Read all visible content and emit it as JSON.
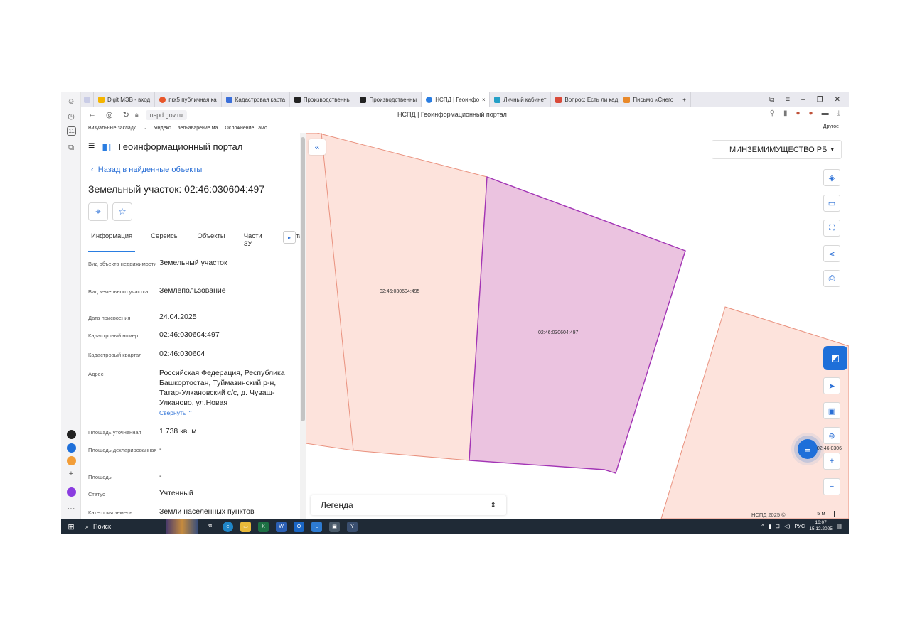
{
  "browser": {
    "tabs": [
      {
        "label": "Digit МЭВ - вход",
        "color": "#f4b400"
      },
      {
        "label": "пкк5 публичная ка",
        "color": "#e8562a"
      },
      {
        "label": "Кадастровая карта",
        "color": "#3b6fd9"
      },
      {
        "label": "Производственны",
        "color": "#222222"
      },
      {
        "label": "Производственны",
        "color": "#222222"
      },
      {
        "label": "НСПД | Геоинфо",
        "color": "#2a7de1",
        "active": true
      },
      {
        "label": "Личный кабинет",
        "color": "#25a0c7"
      },
      {
        "label": "Вопрос: Есть ли кад",
        "color": "#d94a3a"
      },
      {
        "label": "Письмо «Снего",
        "color": "#e8892a"
      }
    ],
    "close_tab": "×",
    "new_tab": "+",
    "url": "nspd.gov.ru",
    "page_title": "НСПД | Геоинформационный портал",
    "bookmarks": [
      "Визуальные закладк",
      "Яндекс",
      "зельаварение ма",
      "Осложнение Тамо"
    ],
    "bookmarks_other": "Другое"
  },
  "sidebar_badge": "11",
  "panel": {
    "portal_title": "Геоинформационный портал",
    "back_link": "Назад в найденные объекты",
    "title": "Земельный участок: 02:46:030604:497",
    "tabs": [
      "Информация",
      "Сервисы",
      "Объекты",
      "Части ЗУ",
      "Соста"
    ],
    "fields": [
      {
        "label": "Вид объекта недвижимости",
        "value": "Земельный участок"
      },
      {
        "label": "Вид земельного участка",
        "value": "Землепользование"
      },
      {
        "label": "Дата присвоения",
        "value": "24.04.2025"
      },
      {
        "label": "Кадастровый номер",
        "value": "02:46:030604:497"
      },
      {
        "label": "Кадастровый квартал",
        "value": "02:46:030604"
      },
      {
        "label": "Адрес",
        "value": "Российская Федерация, Республика Башкортостан, Туймазинский р-н, Татар-Улкановский с/с, д. Чуваш-Улканово, ул.Новая"
      },
      {
        "label": "Площадь уточненная",
        "value": "1 738 кв. м"
      },
      {
        "label": "Площадь декларированная",
        "value": "-"
      },
      {
        "label": "Площадь",
        "value": "-"
      },
      {
        "label": "Статус",
        "value": "Учтенный"
      },
      {
        "label": "Категория земель",
        "value": "Земли населенных пунктов"
      }
    ],
    "collapse_label": "Свернуть"
  },
  "map": {
    "department": "МИНЗЕМИМУЩЕСТВО РБ",
    "plots": [
      {
        "id": "02:46:030604:495",
        "fill": "#fde3dc",
        "stroke": "#e9917e"
      },
      {
        "id": "02:46:030604:497",
        "fill": "#ebc3e0",
        "stroke": "#a234b5",
        "selected": true
      },
      {
        "id": "02:46:0306",
        "fill": "#fde3dc",
        "stroke": "#e9917e"
      }
    ],
    "legend": "Легенда",
    "copyright": "НСПД 2025 ©",
    "scale": "5 м"
  },
  "taskbar": {
    "search": "Поиск",
    "lang": "РУС",
    "time": "16:07",
    "date": "15.12.2025"
  },
  "colors": {
    "accent": "#2a7de1",
    "selected_plot": "#ebc3e0",
    "plot": "#fde3dc"
  }
}
